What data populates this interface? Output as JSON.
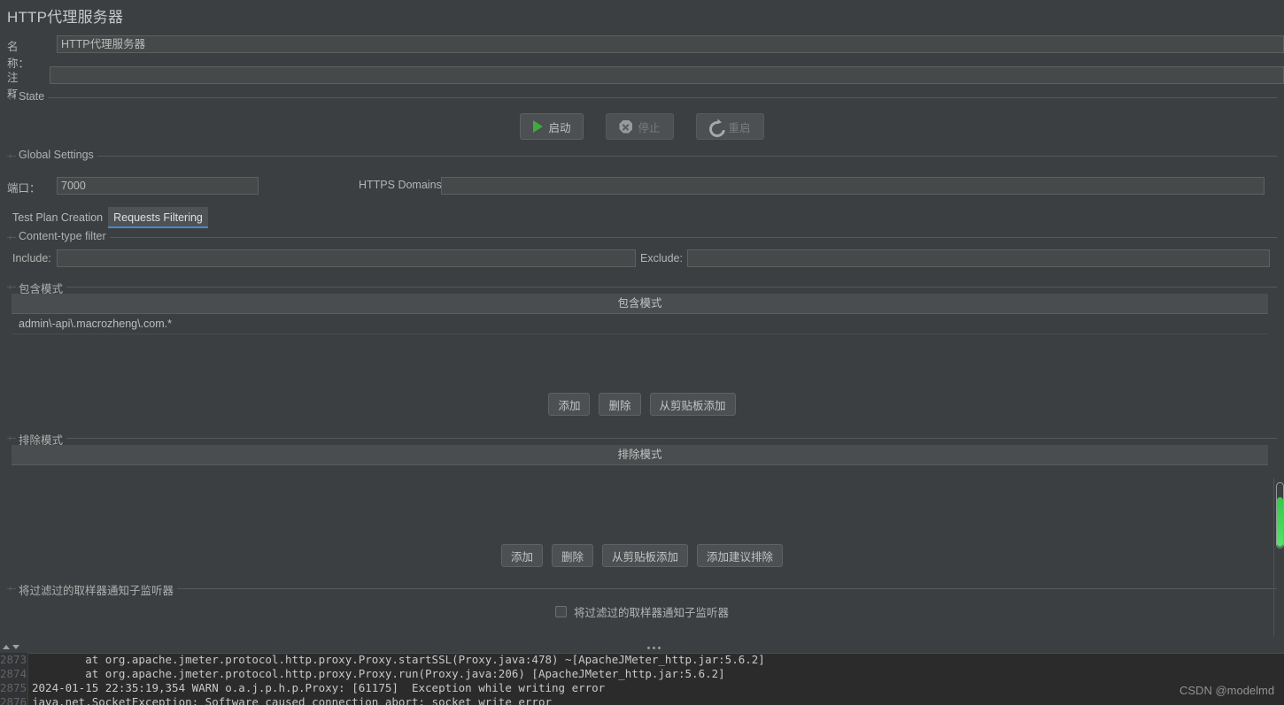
{
  "page": {
    "title": "HTTP代理服务器"
  },
  "form": {
    "name_label": "名称：",
    "name_value": "HTTP代理服务器",
    "comment_label": "注释：",
    "comment_value": ""
  },
  "state": {
    "group_title": "State",
    "start_label": "启动",
    "stop_label": "停止",
    "restart_label": "重启"
  },
  "global_settings": {
    "group_title": "Global Settings",
    "port_label": "端口：",
    "port_value": "7000",
    "https_label": "HTTPS Domains:",
    "https_value": ""
  },
  "tabs": [
    {
      "label": "Test Plan Creation",
      "active": false
    },
    {
      "label": "Requests Filtering",
      "active": true
    }
  ],
  "content_type_filter": {
    "group_title": "Content-type filter",
    "include_label": "Include:",
    "include_value": "",
    "exclude_label": "Exclude:",
    "exclude_value": ""
  },
  "include_patterns": {
    "group_title": "包含模式",
    "column_header": "包含模式",
    "rows": [
      "admin\\-api\\.macrozheng\\.com.*"
    ],
    "buttons": [
      "添加",
      "删除",
      "从剪贴板添加"
    ]
  },
  "exclude_patterns": {
    "group_title": "排除模式",
    "column_header": "排除模式",
    "rows": [],
    "buttons": [
      "添加",
      "删除",
      "从剪贴板添加",
      "添加建议排除"
    ]
  },
  "notify_listeners": {
    "group_title": "将过滤过的取样器通知子监听器",
    "checkbox_label": "将过滤过的取样器通知子监听器",
    "checked": false
  },
  "log_console": {
    "lines": [
      {
        "num": "2873",
        "text": "        at org.apache.jmeter.protocol.http.proxy.Proxy.startSSL(Proxy.java:478) ~[ApacheJMeter_http.jar:5.6.2]"
      },
      {
        "num": "2874",
        "text": "        at org.apache.jmeter.protocol.http.proxy.Proxy.run(Proxy.java:206) [ApacheJMeter_http.jar:5.6.2]"
      },
      {
        "num": "2875",
        "text": "2024-01-15 22:35:19,354 WARN o.a.j.p.h.p.Proxy: [61175]  Exception while writing error"
      },
      {
        "num": "2876",
        "text": "java.net.SocketException: Software caused connection abort: socket write error"
      }
    ]
  },
  "watermark": "CSDN @modelmd",
  "colors": {
    "background": "#3c3f41",
    "field_background": "#45494a",
    "accent_tab": "#4a88c7",
    "scrollbar_green": "#3fd152",
    "start_icon_green": "#3fab3f",
    "console_background": "#2b2b2b"
  }
}
